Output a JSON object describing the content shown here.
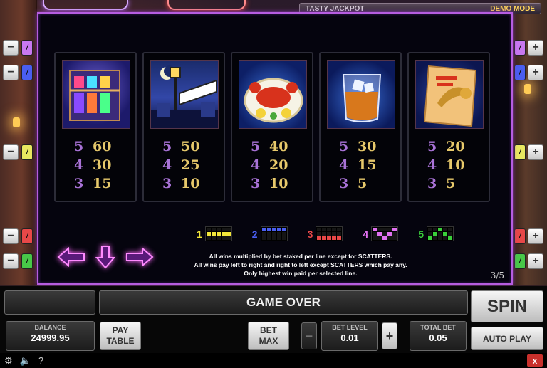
{
  "header": {
    "jackpot_label": "TASTY JACKPOT",
    "mode_label": "DEMO MODE"
  },
  "side_buttons": {
    "minus": "−",
    "plus": "+",
    "left_tabs": [
      {
        "label": "/",
        "color": "#c878f0"
      },
      {
        "label": "/",
        "color": "#4a5ef0"
      },
      {
        "label": "/",
        "color": "#e8e860"
      },
      {
        "label": "/",
        "color": "#e84848"
      },
      {
        "label": "/",
        "color": "#48c848"
      }
    ],
    "right_tabs": [
      {
        "label": "/",
        "color": "#c878f0"
      },
      {
        "label": "/",
        "color": "#4a5ef0"
      },
      {
        "label": "/",
        "color": "#e8e860"
      },
      {
        "label": "/",
        "color": "#e84848"
      },
      {
        "label": "/",
        "color": "#48c848"
      }
    ]
  },
  "symbols": [
    {
      "name": "bar-building-icon",
      "pays": [
        {
          "count": "5",
          "value": "60"
        },
        {
          "count": "4",
          "value": "30"
        },
        {
          "count": "3",
          "value": "15"
        }
      ]
    },
    {
      "name": "street-sign-icon",
      "pays": [
        {
          "count": "5",
          "value": "50"
        },
        {
          "count": "4",
          "value": "25"
        },
        {
          "count": "3",
          "value": "10"
        }
      ]
    },
    {
      "name": "crab-plate-icon",
      "pays": [
        {
          "count": "5",
          "value": "40"
        },
        {
          "count": "4",
          "value": "20"
        },
        {
          "count": "3",
          "value": "10"
        }
      ]
    },
    {
      "name": "whisky-glass-icon",
      "pays": [
        {
          "count": "5",
          "value": "30"
        },
        {
          "count": "4",
          "value": "15"
        },
        {
          "count": "3",
          "value": "5"
        }
      ]
    },
    {
      "name": "jazz-poster-icon",
      "pays": [
        {
          "count": "5",
          "value": "20"
        },
        {
          "count": "4",
          "value": "10"
        },
        {
          "count": "3",
          "value": "5"
        }
      ]
    }
  ],
  "lines": [
    {
      "num": "1",
      "color": "#f2e63a"
    },
    {
      "num": "2",
      "color": "#4a5ef0"
    },
    {
      "num": "3",
      "color": "#e84848"
    },
    {
      "num": "4",
      "color": "#e070f0"
    },
    {
      "num": "5",
      "color": "#3ad03a"
    }
  ],
  "rules": {
    "line1": "All wins multiplied by bet staked per line except for SCATTERS.",
    "line2": "All wins pay left to right and right to left except SCATTERS which pay any.",
    "line3": "Only highest win paid per selected line."
  },
  "page_indicator": "3/5",
  "controls": {
    "status": "GAME OVER",
    "spin": "SPIN",
    "balance_label": "BALANCE",
    "balance_value": "24999.95",
    "pay_table_line1": "PAY",
    "pay_table_line2": "TABLE",
    "bet_max_line1": "BET",
    "bet_max_line2": "MAX",
    "bet_level_label": "BET LEVEL",
    "bet_level_value": "0.01",
    "minus": "−",
    "plus": "+",
    "total_bet_label": "TOTAL BET",
    "total_bet_value": "0.05",
    "auto_play": "AUTO PLAY"
  },
  "footer": {
    "settings_icon": "gear-icon",
    "sound_icon": "speaker-icon",
    "help": "?",
    "close": "x"
  }
}
